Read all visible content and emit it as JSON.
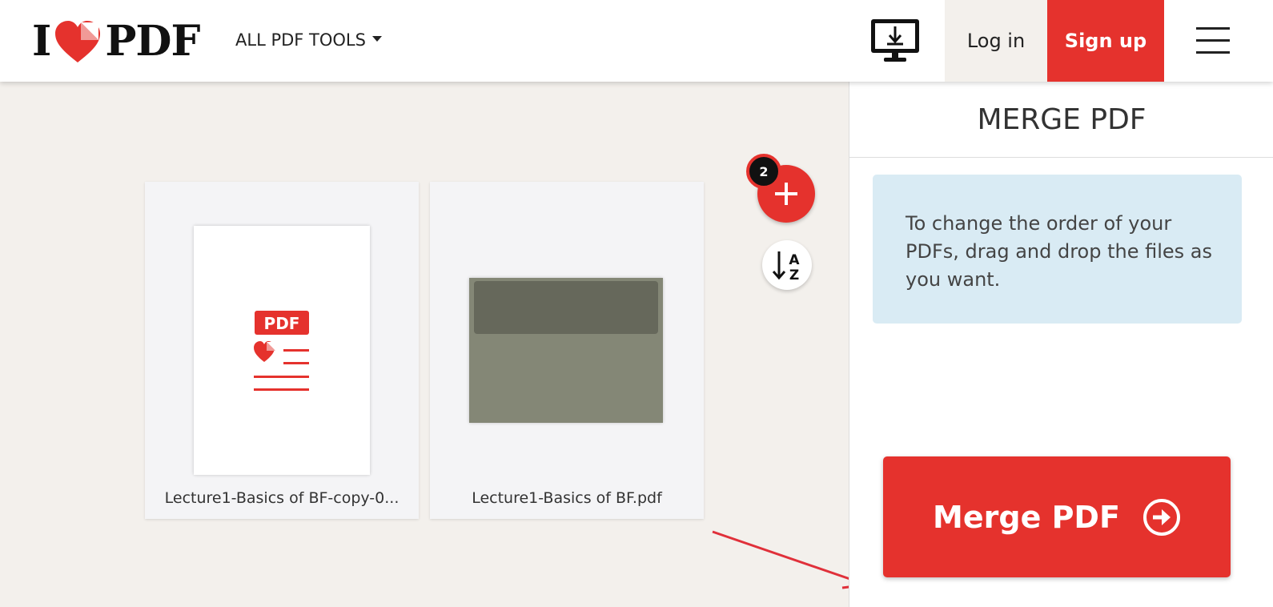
{
  "header": {
    "logo_left": "I",
    "logo_right": "PDF",
    "tools_menu_label": "ALL PDF TOOLS",
    "login_label": "Log in",
    "signup_label": "Sign up"
  },
  "workspace": {
    "file_count": "2",
    "files": [
      {
        "name": "Lecture1-Basics of BF-copy-0...",
        "thumb_label": "PDF"
      },
      {
        "name": "Lecture1-Basics of BF.pdf"
      }
    ],
    "sort_label_top": "A",
    "sort_label_bottom": "Z"
  },
  "sidebar": {
    "title": "MERGE PDF",
    "info_text": "To change the order of your PDFs, drag and drop the files as you want.",
    "merge_button_label": "Merge PDF"
  },
  "colors": {
    "brand_red": "#e5322d",
    "info_bg": "#d9ebf4",
    "workspace_bg": "#f3f0ec"
  }
}
